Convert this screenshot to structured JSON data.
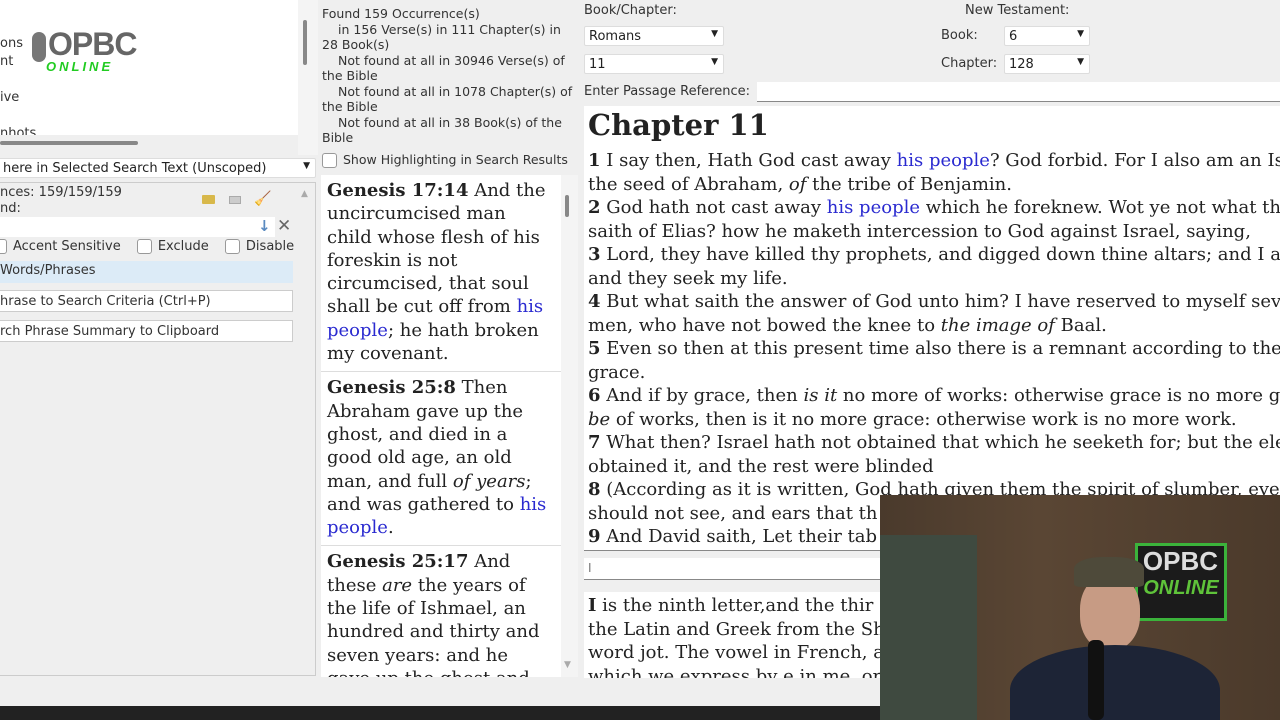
{
  "left": {
    "tree_items": [
      "ons",
      "nt",
      "ive",
      "nhots"
    ],
    "logo_text": "OPBC ONLINE",
    "scope_dropdown": "here in Selected Search Text (Unscoped)",
    "instances": "nces: 159/159/159",
    "found_label": "nd:",
    "search_input": "",
    "checkboxes": [
      "Accent Sensitive",
      "Exclude",
      "Disable"
    ],
    "words_phrases": "Words/Phrases",
    "add_phrase_button": "hrase to Search Criteria (Ctrl+P)",
    "copy_summary_button": "rch Phrase Summary to Clipboard"
  },
  "stats": {
    "line1": "Found 159 Occurrence(s)",
    "line2": "in 156 Verse(s) in 111 Chapter(s) in 28 Book(s)",
    "line3": "Not found at all in 30946 Verse(s) of the Bible",
    "line4": "Not found at all in 1078 Chapter(s) of the Bible",
    "line5": "Not found at all in 38 Book(s) of the Bible",
    "highlight_label": "Show Highlighting in Search Results"
  },
  "results": [
    {
      "ref": "Genesis 17:14",
      "t1": " And the uncircumcised man child whose flesh of his foreskin is not circumcised, that soul shall be cut off from ",
      "hl": "his people",
      "t2": "; he hath broken my covenant."
    },
    {
      "ref": "Genesis 25:8",
      "t1": " Then Abraham gave up the ghost, and died in a good old age, an old man, and full ",
      "it": "of years",
      "t2": "; and was gathered to ",
      "hl": "his people",
      "t3": "."
    },
    {
      "ref": "Genesis 25:17",
      "t1": " And these ",
      "it": "are",
      "t2": " the years of the life of Ishmael, an hundred and thirty and seven years: and he gave up the ghost and"
    }
  ],
  "nav": {
    "book_chapter_label": "Book/Chapter:",
    "book": "Romans",
    "chapter": "11",
    "testament_label": "New Testament:",
    "book_num_label": "Book:",
    "book_num": "6",
    "chapter_num_label": "Chapter:",
    "chapter_num": "128",
    "passage_label": "Enter Passage Reference:",
    "passage_value": ""
  },
  "chapter": {
    "title": "Chapter 11",
    "verses": [
      {
        "n": "1",
        "a": " I say then, Hath God cast away ",
        "hl": "his people",
        "b": "? God forbid. For I also am an Is",
        "c": "the seed of Abraham, ",
        "it": "of",
        "d": " the tribe of Benjamin."
      },
      {
        "n": "2",
        "a": " God hath not cast away ",
        "hl": "his people",
        "b": " which he foreknew. Wot ye not what th",
        "c": "saith of Elias? how he maketh intercession to God against Israel, saying,"
      },
      {
        "n": "3",
        "a": " Lord, they have killed thy prophets, and digged down thine altars; and I a",
        "c": "and they seek my life."
      },
      {
        "n": "4",
        "a": " But what saith the answer of God unto him? I have reserved to myself sev",
        "c": "men, who have not bowed the knee to ",
        "it": "the image of",
        "d": " Baal."
      },
      {
        "n": "5",
        "a": " Even so then at this present time also there is a remnant according to the",
        "c": "grace."
      },
      {
        "n": "6",
        "a": " And if by grace, then ",
        "it": "is it",
        "b": " no more of works: otherwise grace is no more gr",
        "it2": "be",
        "c": " of works, then is it no more grace: otherwise work is no more work."
      },
      {
        "n": "7",
        "a": " What then? Israel hath not obtained that which he seeketh for; but the ele",
        "c": "obtained it, and the rest were blinded"
      },
      {
        "n": "8",
        "a": " (According as it is written, God hath given them the spirit of slumber, eye",
        "c": "should not see, and ears that th"
      },
      {
        "n": "9",
        "a": " And David saith, Let their tab"
      }
    ]
  },
  "dictionary": {
    "word_input": "I",
    "head": "I",
    "lines": [
      " is the ninth letter,and the thir",
      "the Latin and Greek from the Sh",
      "word jot. The vowel in French, a",
      "which we express by e in me, or"
    ]
  },
  "webcam": {
    "sign_line1": "OPBC",
    "sign_line2": "ONLINE"
  }
}
